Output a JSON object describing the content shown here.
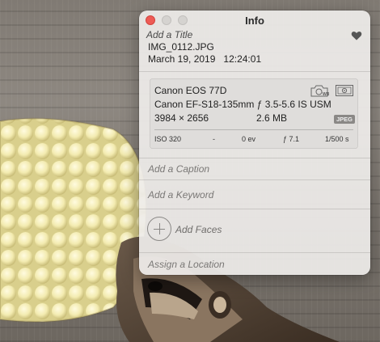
{
  "window": {
    "title": "Info"
  },
  "photo": {
    "title_placeholder": "Add a Title",
    "filename": "IMG_0112.JPG",
    "date": "March 19, 2019",
    "time": "12:24:01",
    "favorite_icon": "heart-icon"
  },
  "exif": {
    "camera": "Canon EOS 77D",
    "lens": "Canon EF-S18-135mm ƒ 3.5-5.6 IS USM",
    "dimensions": "3984 × 2656",
    "file_size": "2.6 MB",
    "format_badge": "JPEG",
    "wb_icon_label": "WB",
    "iso": "ISO 320",
    "focal_length": "-",
    "exposure_compensation": "0 ev",
    "aperture": "ƒ 7.1",
    "shutter": "1/500 s"
  },
  "fields": {
    "caption_placeholder": "Add a Caption",
    "keyword_placeholder": "Add a Keyword",
    "faces_label": "Add Faces",
    "location_placeholder": "Assign a Location"
  },
  "colors": {
    "close_button": "#ee5b55",
    "panel_bg": "#eeecea",
    "placeholder_text": "#7a7876"
  }
}
